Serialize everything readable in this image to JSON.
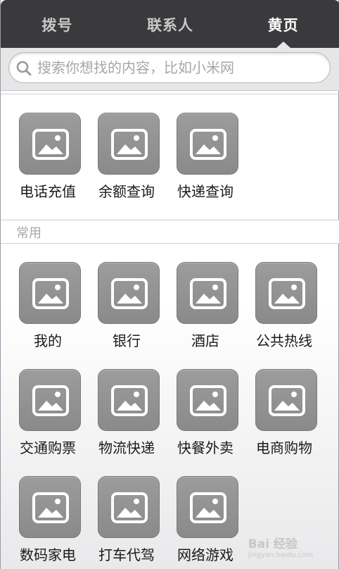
{
  "tabs": [
    {
      "label": "拨号",
      "active": false
    },
    {
      "label": "联系人",
      "active": false
    },
    {
      "label": "黄页",
      "active": true
    }
  ],
  "search": {
    "placeholder": "搜索你想找的内容，比如小米网"
  },
  "quick_actions": [
    {
      "label": "电话充值",
      "icon": "image-placeholder-icon"
    },
    {
      "label": "余额查询",
      "icon": "image-placeholder-icon"
    },
    {
      "label": "快递查询",
      "icon": "image-placeholder-icon"
    }
  ],
  "common_section": {
    "title": "常用",
    "items": [
      {
        "label": "我的",
        "icon": "image-placeholder-icon"
      },
      {
        "label": "银行",
        "icon": "image-placeholder-icon"
      },
      {
        "label": "酒店",
        "icon": "image-placeholder-icon"
      },
      {
        "label": "公共热线",
        "icon": "image-placeholder-icon"
      },
      {
        "label": "交通购票",
        "icon": "image-placeholder-icon"
      },
      {
        "label": "物流快递",
        "icon": "image-placeholder-icon"
      },
      {
        "label": "快餐外卖",
        "icon": "image-placeholder-icon"
      },
      {
        "label": "电商购物",
        "icon": "image-placeholder-icon"
      },
      {
        "label": "数码家电",
        "icon": "image-placeholder-icon"
      },
      {
        "label": "打车代驾",
        "icon": "image-placeholder-icon"
      },
      {
        "label": "网络游戏",
        "icon": "image-placeholder-icon"
      }
    ]
  },
  "watermark": {
    "text": "Bai 经验",
    "sub": "jingyan.baidu.com"
  },
  "colors": {
    "tabbar": "#3a3a3d",
    "tile": "#929292",
    "active_tab": "#ffffff"
  }
}
